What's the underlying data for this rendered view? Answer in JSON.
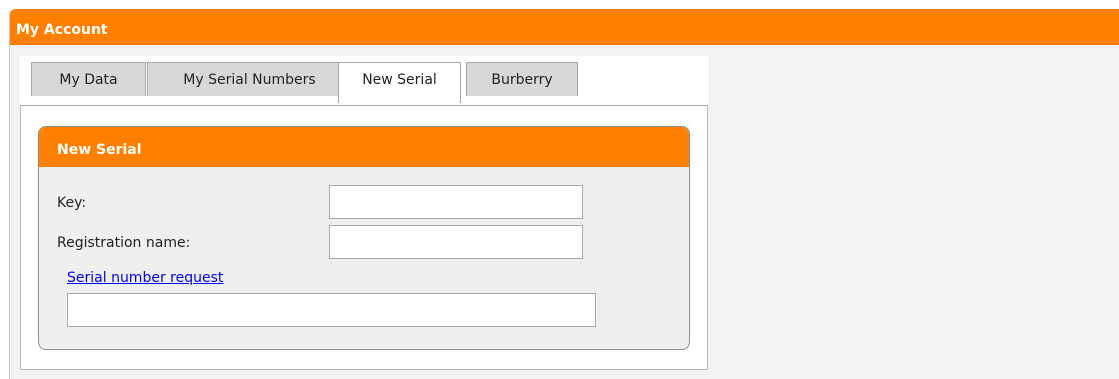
{
  "panel": {
    "title": "My Account"
  },
  "tabs": [
    {
      "label": "My Data"
    },
    {
      "label": "My Serial Numbers"
    },
    {
      "label": "New Serial"
    },
    {
      "label": "Burberry"
    }
  ],
  "active_tab": "New Serial",
  "new_serial": {
    "title": "New Serial",
    "key_label": "Key:",
    "key_value": "",
    "reg_name_label": "Registration name:",
    "reg_name_value": "",
    "request_link": "Serial number request",
    "request_value": ""
  },
  "colors": {
    "accent": "#ff8000",
    "link": "#0000ee",
    "panel_bg": "#f2f2f2"
  }
}
